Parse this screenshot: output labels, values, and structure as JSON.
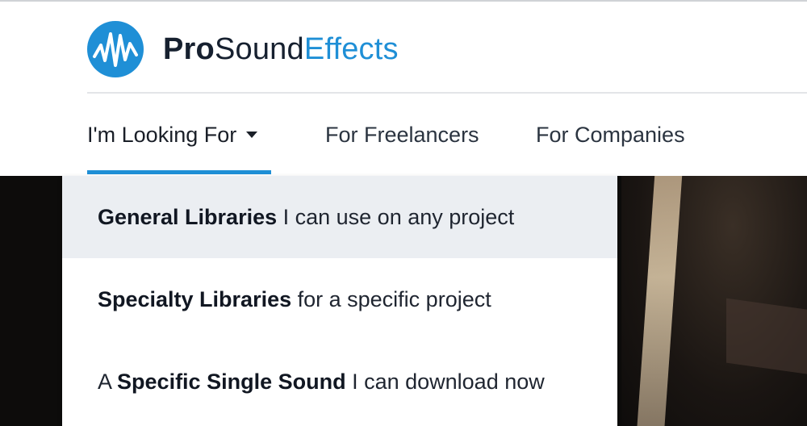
{
  "brand": {
    "part_pro": "Pro",
    "part_sound": "Sound",
    "part_effects": "Effects",
    "logo_icon": "soundwave-logo-icon",
    "colors": {
      "accent": "#1f8fd6",
      "dark": "#16202f"
    }
  },
  "nav": {
    "items": [
      {
        "label": "I'm Looking For",
        "has_caret": true,
        "active": true
      },
      {
        "label": "For Freelancers"
      },
      {
        "label": "For Companies"
      }
    ]
  },
  "dropdown": {
    "items": [
      {
        "strong_prefix": "",
        "strong": "General Libraries",
        "rest": " I can use on any project",
        "highlighted": true
      },
      {
        "strong_prefix": "",
        "strong": "Specialty Libraries",
        "rest": " for a specific project"
      },
      {
        "strong_prefix": "A ",
        "strong": "Specific Single Sound",
        "rest": " I can download now"
      }
    ]
  }
}
